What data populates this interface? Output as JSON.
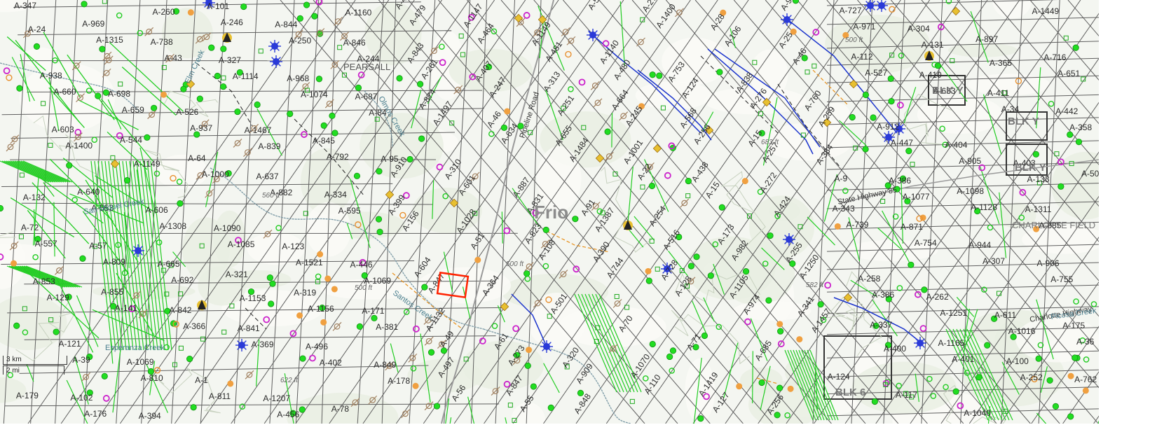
{
  "map": {
    "county_label": "Frio",
    "block_labels": [
      "BLK Y",
      "BLK Y",
      "BLK 6",
      "BLK Y"
    ],
    "place_labels": [
      "PEARSALL",
      "CHARLOTTE FIELD"
    ],
    "road_labels": [
      "State Highway 85",
      "Pipeline Road",
      "Charlotte Highway"
    ],
    "creek_labels": [
      "Elm Creek",
      "Olmos Creek",
      "San Miguel Creek",
      "Esperanza Creek",
      "Picosa Creek",
      "Santos Creek"
    ],
    "contour_labels": [
      "683 ft",
      "500 ft",
      "582 ft",
      "622 ft",
      "560 ft",
      "500 ft",
      "500 ft"
    ],
    "survey_labels": [
      "A-347",
      "A-969",
      "A-738",
      "A-327",
      "A-968",
      "A-687",
      "A-874",
      "A-46",
      "A-655",
      "A-1001",
      "A-438",
      "A-272",
      "A-343",
      "A-871",
      "A-944",
      "A-906",
      "A-853",
      "A-855",
      "A-842",
      "A-841",
      "A-496",
      "A-849",
      "A-497",
      "A-847",
      "A-848",
      "A-27",
      "A-28",
      "A-25",
      "A-112",
      "A-410",
      "A-411",
      "A-442",
      "A-603",
      "A-544",
      "A-64",
      "A-637",
      "A-334",
      "A-399",
      "A-1028",
      "A-823",
      "A-390",
      "A-728",
      "A-1105",
      "A-341",
      "A-337",
      "A-1165",
      "A-100",
      "A-762",
      "A-102",
      "A-394",
      "A-101",
      "A-844",
      "A-846",
      "A-843",
      "A-407",
      "A-313",
      "A-664",
      "A-568",
      "A-15",
      "A-384",
      "A-386",
      "A-1098",
      "A-1311",
      "A-72",
      "A-57",
      "A-665",
      "A-321",
      "A-319",
      "A-171",
      "A-1132",
      "A-61",
      "A-320",
      "A-1070",
      "A-1419",
      "A-256",
      "A-727",
      "A-304",
      "A-897",
      "A-716",
      "A-938",
      "A-698",
      "A-526",
      "A-1467",
      "A-845",
      "A-95",
      "A-310",
      "A-887",
      "A-91",
      "A-254",
      "A-173",
      "A-255",
      "A-258",
      "A-262",
      "A-611",
      "A-175",
      "A-121",
      "A-1069",
      "A-1",
      "A-1207",
      "A-78",
      "A-489",
      "A-1147",
      "A-1149",
      "A-1140",
      "A-753",
      "A-838",
      "A-760",
      "A-912",
      "A-404",
      "A-403",
      "A-508",
      "A-640",
      "A-606",
      "A-1090",
      "A-123",
      "A-446",
      "A-604",
      "A-364",
      "A-501",
      "A-70",
      "A-71",
      "A-685",
      "A-124",
      "A-117",
      "A-1040",
      "A-1449",
      "A-24",
      "A-1315",
      "A-43",
      "A-1114",
      "A-1074",
      "A-84",
      "A-1497",
      "A-634",
      "A-1484",
      "A-22",
      "A-15",
      "A-424",
      "A-739",
      "A-754",
      "A-307",
      "A-755",
      "A-129",
      "A-141",
      "A-366",
      "A-369",
      "A-402",
      "A-178",
      "A-56",
      "A-55",
      "A-502",
      "A-1400",
      "A-106",
      "A-46",
      "A-527",
      "A-633",
      "A-34",
      "A-358",
      "A-1400",
      "A-1149",
      "A-1000",
      "A-882",
      "A-595",
      "A-156",
      "A-51",
      "A-108",
      "A-744",
      "A-128",
      "A-974",
      "A-1457",
      "A-400",
      "A-401",
      "A-252",
      "A-179",
      "A-176",
      "A-260",
      "A-246",
      "A-250",
      "A-244",
      "A-261",
      "A-247",
      "A-251",
      "A-245",
      "A-256",
      "A-257",
      "A-9",
      "A-1077",
      "A-1128",
      "A-885",
      "A-557",
      "A-809",
      "A-692",
      "A-1153",
      "A-1156",
      "A-381",
      "A-49",
      "A-273",
      "A-909",
      "A-110",
      "A-127",
      "A-958",
      "A-971",
      "A-131",
      "A-365",
      "A-651",
      "A-660",
      "A-659",
      "A-937",
      "A-839",
      "A-792",
      "A-910",
      "A-601",
      "A-831",
      "A-1387",
      "A-516",
      "A-982",
      "A-1250",
      "A-386",
      "A-1251",
      "A-1016",
      "A-36",
      "A-39",
      "A-810",
      "A-811",
      "A-456",
      "A-1160",
      "A-479",
      "A-464",
      "A-481",
      "A-480",
      "A-124",
      "A-276",
      "A-259",
      "A-447",
      "A-905",
      "A-133",
      "A-132",
      "A-553",
      "A-1308",
      "A-1085",
      "A-1521",
      "A-1069",
      "A-847"
    ]
  },
  "scale": {
    "km": "3 km",
    "mi": "2 mi"
  }
}
